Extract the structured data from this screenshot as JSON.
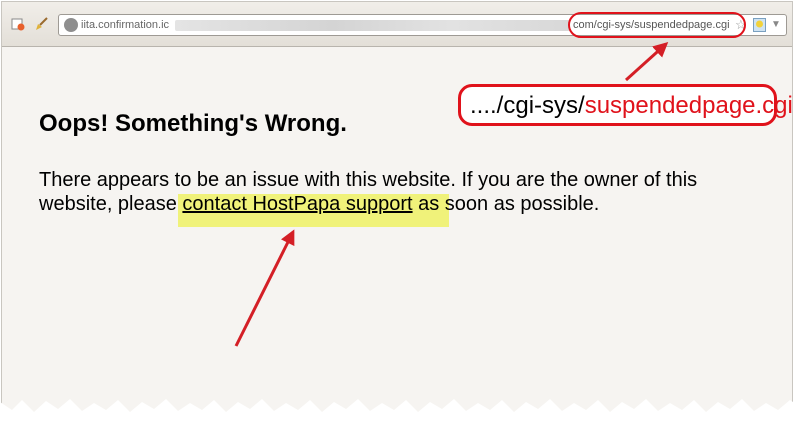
{
  "browser": {
    "url_left": "iita.confirmation.ic",
    "url_right": "com/cgi-sys/suspendedpage.cgi",
    "icons": [
      "ie-icon",
      "broom-icon",
      "globe-icon",
      "star-icon",
      "bulb-icon",
      "dropdown-icon"
    ]
  },
  "page": {
    "heading": "Oops! Something's Wrong.",
    "message_before": "There appears to be an issue with this website. If you are the owner of this website, please ",
    "link_text": "contact HostPapa support",
    "message_after": " as soon as possible."
  },
  "annotation": {
    "callout_prefix": "..../cgi-sys/",
    "callout_accent": "suspendedpage.cgi",
    "accent_color": "#e0121b",
    "highlight_color": "#f0f27a"
  }
}
